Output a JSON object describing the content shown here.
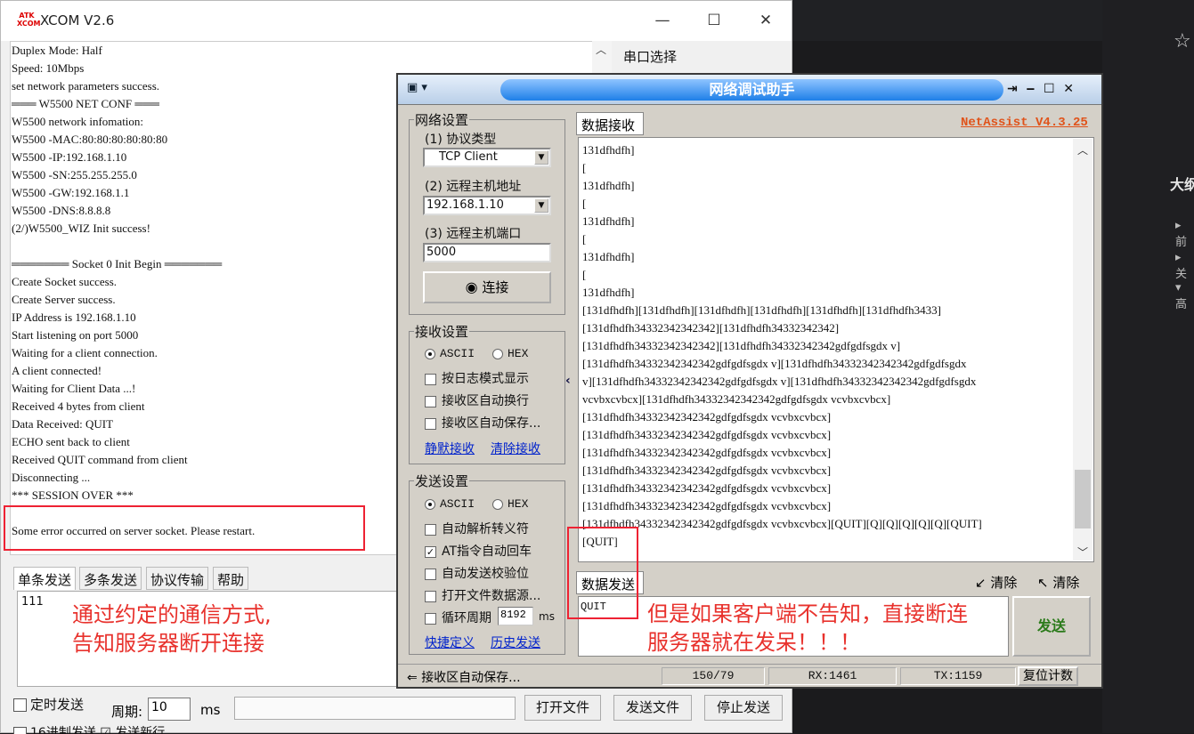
{
  "xcom": {
    "title": "XCOM V2.6",
    "logo_text": "ATK XCOM",
    "controls": [
      "—",
      "☐",
      "✕"
    ],
    "log_lines": [
      "Duplex Mode: Half",
      "Speed: 10Mbps",
      "set network parameters success.",
      "═══ W5500 NET CONF ═══",
      "W5500 network infomation:",
      "W5500 -MAC:80:80:80:80:80:80",
      "W5500 -IP:192.168.1.10",
      "W5500 -SN:255.255.255.0",
      "W5500 -GW:192.168.1.1",
      "W5500 -DNS:8.8.8.8",
      "(2/)W5500_WIZ Init success!",
      "",
      "═══════ Socket 0 Init Begin ═══════",
      "Create Socket success.",
      "Create Server success.",
      "IP Address is 192.168.1.10",
      "Start listening on port 5000",
      "Waiting for a client connection.",
      "A client connected!",
      "Waiting for Client Data ...!",
      "Received 4 bytes from client",
      "Data Received: QUIT",
      "ECHO sent back to client",
      "Received QUIT command from client",
      "Disconnecting ...",
      "*** SESSION OVER ***",
      "",
      "Some error occurred on server socket. Please restart."
    ],
    "port_select_label": "串口选择",
    "tabs": [
      "单条发送",
      "多条发送",
      "协议传输",
      "帮助"
    ],
    "send_value": "111",
    "annotation": "通过约定的通信方式,\n告知服务器断开连接",
    "timed_send_label": "定时发送",
    "period_label": "周期:",
    "period_value": "10",
    "ms_label": "ms",
    "open_file": "打开文件",
    "send_file": "发送文件",
    "stop_send": "停止发送",
    "bottom_row": "16进制发送  ☑ 发送新行"
  },
  "netassist": {
    "title": "网络调试助手",
    "version": "NetAssist V4.3.25",
    "net_settings": "网络设置",
    "protocol_label": "(1) 协议类型",
    "protocol_value": "TCP Client",
    "host_label": "(2) 远程主机地址",
    "host_value": "192.168.1.10",
    "port_label": "(3) 远程主机端口",
    "port_value": "5000",
    "connect_button": "连接",
    "recv_settings": "接收设置",
    "ascii": "ASCII",
    "hex": "HEX",
    "recv_opts": [
      "按日志模式显示",
      "接收区自动换行",
      "接收区自动保存..."
    ],
    "save_recv": "静默接收",
    "clear_recv": "清除接收",
    "send_settings": "发送设置",
    "send_opts": [
      "自动解析转义符",
      "AT指令自动回车",
      "自动发送校验位",
      "打开文件数据源..."
    ],
    "send_opts_checked": [
      false,
      true,
      false,
      false
    ],
    "loop_label": "循环周期",
    "loop_value": "8192",
    "loop_unit": "ms",
    "shortcut": "快捷定义",
    "history": "历史发送",
    "recv_tab": "数据接收",
    "recv_lines": [
      "131dfhdfh]",
      "[",
      "131dfhdfh]",
      "[",
      "131dfhdfh]",
      "[",
      "131dfhdfh]",
      "[",
      "131dfhdfh]",
      "[131dfhdfh][131dfhdfh][131dfhdfh][131dfhdfh][131dfhdfh][131dfhdfh3433]",
      "[131dfhdfh34332342342342][131dfhdfh34332342342]",
      "[131dfhdfh34332342342342][131dfhdfh34332342342gdfgdfsgdx v]",
      "[131dfhdfh34332342342342gdfgdfsgdx v][131dfhdfh34332342342342gdfgdfsgdx",
      "v][131dfhdfh34332342342342gdfgdfsgdx v][131dfhdfh34332342342342gdfgdfsgdx",
      "vcvbxcvbcx][131dfhdfh34332342342342gdfgdfsgdx vcvbxcvbcx]",
      "[131dfhdfh34332342342342gdfgdfsgdx vcvbxcvbcx]",
      "[131dfhdfh34332342342342gdfgdfsgdx vcvbxcvbcx]",
      "[131dfhdfh34332342342342gdfgdfsgdx vcvbxcvbcx]",
      "[131dfhdfh34332342342342gdfgdfsgdx vcvbxcvbcx]",
      "[131dfhdfh34332342342342gdfgdfsgdx vcvbxcvbcx]",
      "[131dfhdfh34332342342342gdfgdfsgdx vcvbxcvbcx]",
      "[131dfhdfh34332342342342gdfgdfsgdx vcvbxcvbcx][QUIT][Q][Q][Q][Q][Q][QUIT]",
      "[QUIT]"
    ],
    "send_tab": "数据发送",
    "clear_label": "清除",
    "send_value": "QUIT",
    "send_button": "发送",
    "annotation": "但是如果客户端不告知，直接断连\n服务器就在发呆！！！",
    "status_saving": "接收区自动保存...",
    "status_ratio": "150/79",
    "status_rx": "RX:1461",
    "status_tx": "TX:1159",
    "reset_count": "复位计数"
  },
  "background": {
    "heading": "大纲",
    "items": [
      "前",
      "关",
      "高"
    ]
  }
}
